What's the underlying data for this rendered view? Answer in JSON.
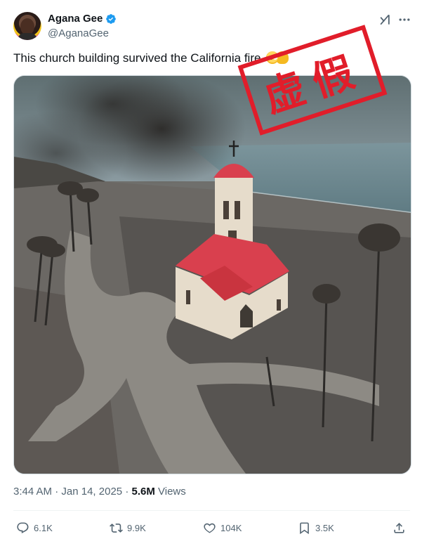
{
  "author": {
    "display_name": "Agana Gee",
    "handle": "@AganaGee",
    "verified": true
  },
  "icons": {
    "verified": "verified-badge-icon",
    "grok": "grok-icon",
    "more": "more-options-icon",
    "reply": "reply-icon",
    "retweet": "retweet-icon",
    "like": "heart-icon",
    "bookmark": "bookmark-icon",
    "share": "share-icon"
  },
  "tweet": {
    "text": "This church building survived the California fire",
    "emojis": [
      "flushed-face",
      "folded-hands"
    ]
  },
  "image": {
    "stamp_text": "虚假",
    "stamp_color": "#e11d2a"
  },
  "meta": {
    "time": "3:44 AM",
    "separator": "·",
    "date": "Jan 14, 2025",
    "views_count": "5.6M",
    "views_label": "Views"
  },
  "actions": {
    "replies": "6.1K",
    "retweets": "9.9K",
    "likes": "104K",
    "bookmarks": "3.5K"
  },
  "colors": {
    "verified_blue": "#1d9bf0",
    "secondary_text": "#536471",
    "roof_red": "#d9404e"
  }
}
